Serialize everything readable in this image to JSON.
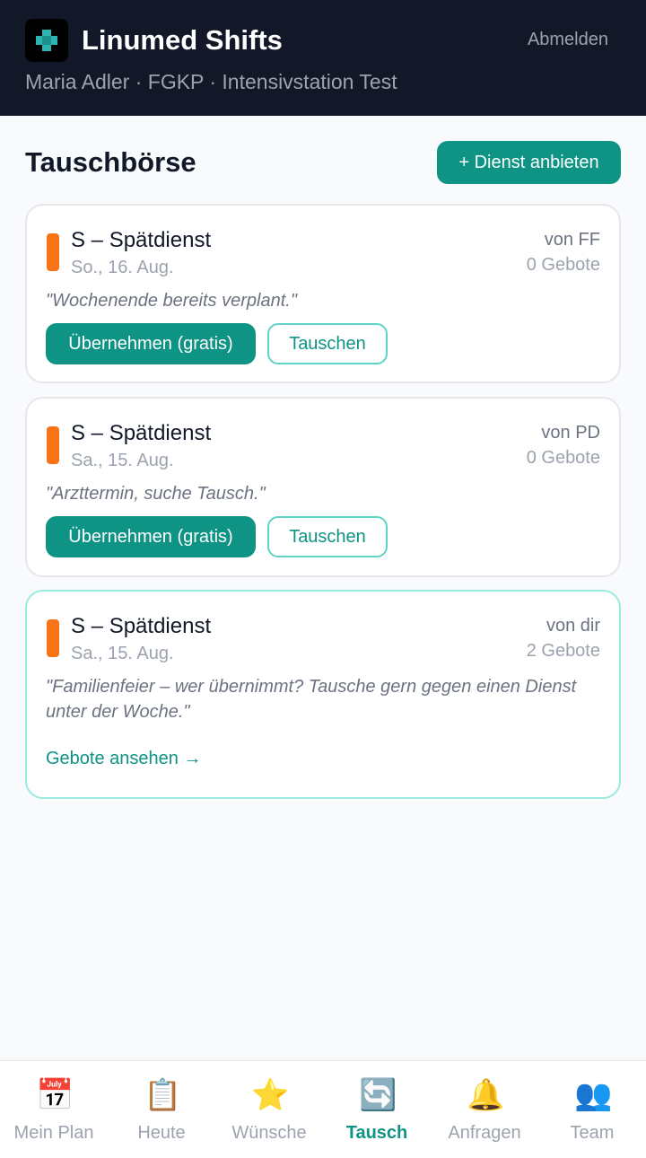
{
  "header": {
    "app_title": "Linumed Shifts",
    "logout_label": "Abmelden",
    "user_line": "Maria Adler · FGKP · Intensivstation Test",
    "logo_icon": "medical-cross-icon"
  },
  "main": {
    "title": "Tauschbörse",
    "offer_button": "+ Dienst anbieten",
    "cards": [
      {
        "shift": "S – Spätdienst",
        "date": "So., 16. Aug.",
        "by": "von FF",
        "bids": "0 Gebote",
        "note": "\"Wochenende bereits verplant.\"",
        "take_label": "Übernehmen (gratis)",
        "swap_label": "Tauschen",
        "shift_color": "#f97316"
      },
      {
        "shift": "S – Spätdienst",
        "date": "Sa., 15. Aug.",
        "by": "von PD",
        "bids": "0 Gebote",
        "note": "\"Arzttermin, suche Tausch.\"",
        "take_label": "Übernehmen (gratis)",
        "swap_label": "Tauschen",
        "shift_color": "#f97316"
      },
      {
        "shift": "S – Spätdienst",
        "date": "Sa., 15. Aug.",
        "by": "von dir",
        "bids": "2 Gebote",
        "note": "\"Familienfeier – wer übernimmt? Tausche gern gegen einen Dienst unter der Woche.\"",
        "view_bids_label": "Gebote ansehen →",
        "shift_color": "#f97316"
      }
    ]
  },
  "nav": {
    "items": [
      {
        "label": "Mein Plan",
        "icon": "calendar-icon",
        "glyph": "📅"
      },
      {
        "label": "Heute",
        "icon": "clipboard-icon",
        "glyph": "📋"
      },
      {
        "label": "Wünsche",
        "icon": "star-icon",
        "glyph": "⭐"
      },
      {
        "label": "Tausch",
        "icon": "swap-arrows-icon",
        "glyph": "🔄"
      },
      {
        "label": "Anfragen",
        "icon": "bell-icon",
        "glyph": "🔔"
      },
      {
        "label": "Team",
        "icon": "team-icon",
        "glyph": "👥"
      }
    ],
    "active": "Tausch"
  },
  "colors": {
    "accent": "#0e9384",
    "header_bg": "#121828",
    "shift_late": "#f97316"
  }
}
